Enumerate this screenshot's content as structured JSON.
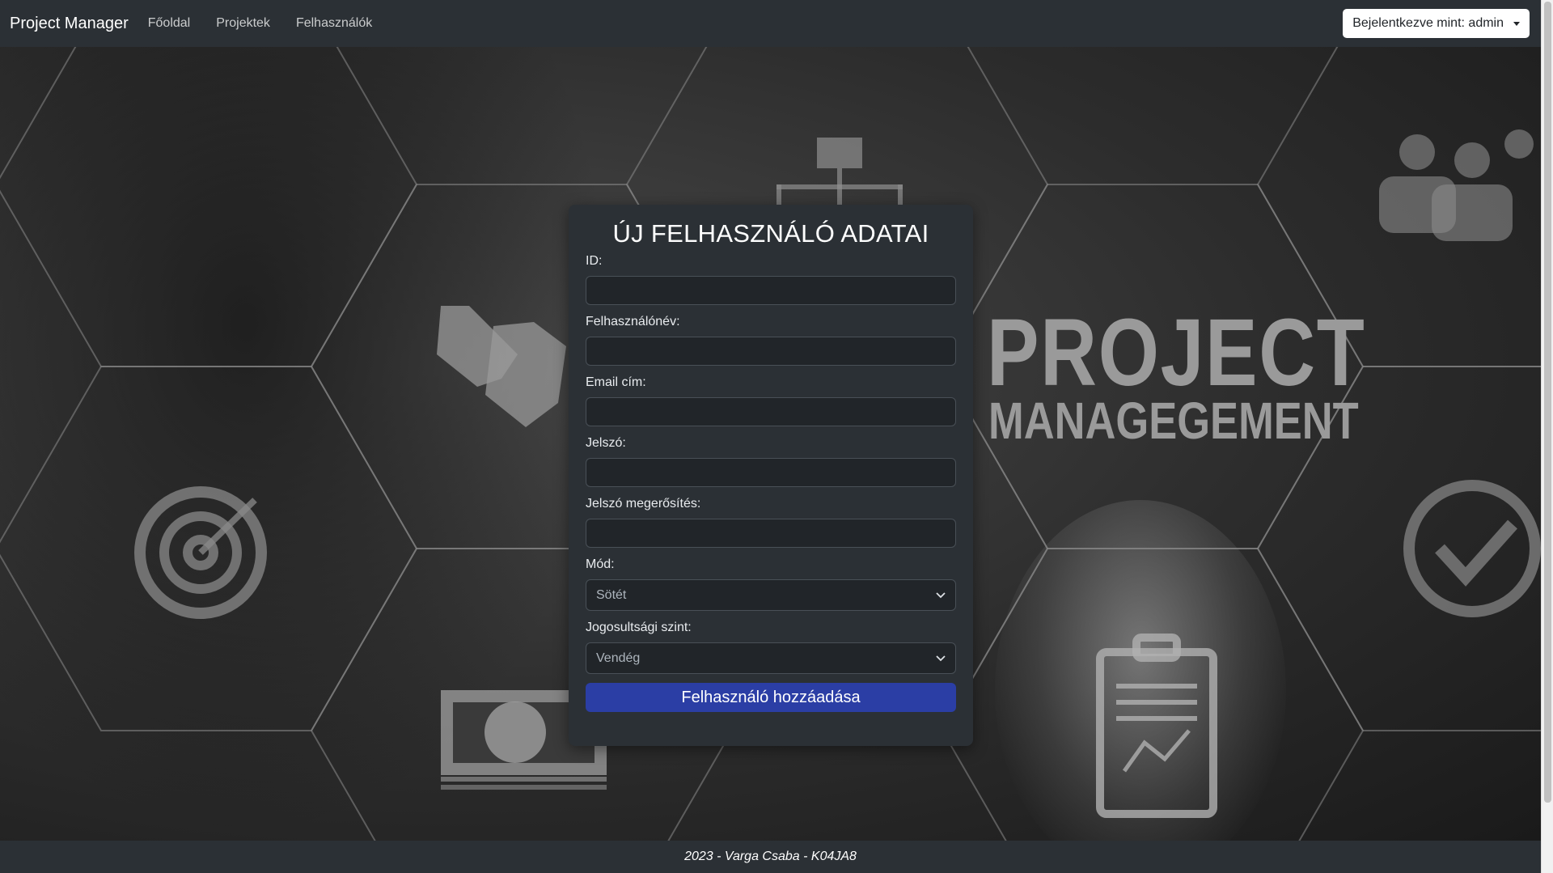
{
  "navbar": {
    "brand": "Project Manager",
    "links": [
      "Főoldal",
      "Projektek",
      "Felhasználók"
    ],
    "user_dropdown": "Bejelentkezve mint: admin"
  },
  "background": {
    "line1": "PROJECT",
    "line2": "MANAGEGEMENT"
  },
  "form": {
    "title": "ÚJ FELHASZNÁLÓ ADATAI",
    "fields": {
      "id_label": "ID:",
      "username_label": "Felhasználónév:",
      "email_label": "Email cím:",
      "password_label": "Jelszó:",
      "password_confirm_label": "Jelszó megerősítés:",
      "mode_label": "Mód:",
      "mode_value": "Sötét",
      "role_label": "Jogosultsági szint:",
      "role_value": "Vendég"
    },
    "submit_label": "Felhasználó hozzáadása"
  },
  "footer": {
    "text": "2023 - Varga Csaba - K04JA8"
  },
  "colors": {
    "navbar_bg": "#2b3035",
    "card_bg": "#2b3035",
    "input_bg": "#212529",
    "submit_bg": "#2b3ea5"
  }
}
